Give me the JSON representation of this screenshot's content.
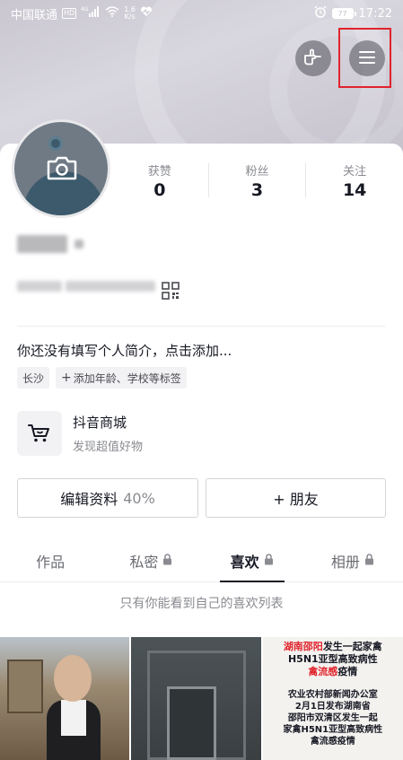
{
  "status_bar": {
    "carrier": "中国联通",
    "hd": "HD",
    "network": "4G",
    "speed": "1.6",
    "speed_unit": "K/s",
    "battery": "77",
    "time": "17:22"
  },
  "profile": {
    "stats": [
      {
        "label": "获赞",
        "value": "0"
      },
      {
        "label": "粉丝",
        "value": "3"
      },
      {
        "label": "关注",
        "value": "14"
      }
    ],
    "bio": "你还没有填写个人简介，点击添加...",
    "tags": [
      "长沙",
      "添加年龄、学校等标签"
    ],
    "tag_add_symbol": "+"
  },
  "shop": {
    "title": "抖音商城",
    "subtitle": "发现超值好物"
  },
  "actions": {
    "edit_label": "编辑资料",
    "edit_percent": "40%",
    "friend_label": "+ 朋友"
  },
  "tabs": [
    {
      "label": "作品",
      "locked": false
    },
    {
      "label": "私密",
      "locked": true
    },
    {
      "label": "喜欢",
      "locked": true,
      "active": true
    },
    {
      "label": "相册",
      "locked": true
    }
  ],
  "notice": "只有你能看到自己的喜欢列表",
  "thumb3": {
    "title_red": "湖南邵阳",
    "title_black": "发生一起家禽",
    "title_line2": "H5N1亚型高致病性",
    "title_line3": "禽流感",
    "title_line3_tail": "疫情",
    "body_line1": "农业农村部新闻办公室",
    "body_line2": "2月1日发布湖南省",
    "body_line3": "邵阳市双清区发生一起",
    "body_line4": "家禽H5N1亚型高致病性",
    "body_line5": "禽流感疫情"
  },
  "colors": {
    "accent_red": "#e1232c",
    "text_primary": "#161823",
    "text_secondary": "#8a8b91"
  }
}
